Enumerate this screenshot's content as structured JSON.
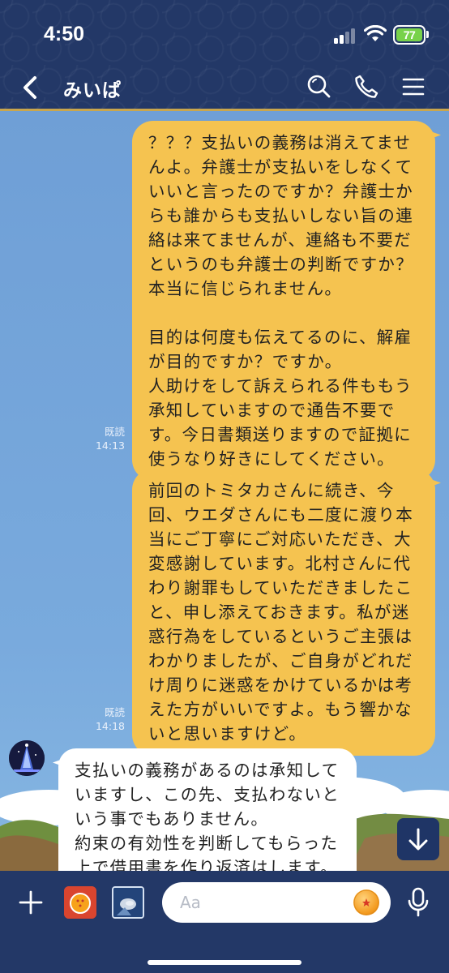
{
  "status_bar": {
    "time": "4:50",
    "battery": "77",
    "colors": {
      "battery": "#78d24a"
    }
  },
  "header": {
    "title": "みいぱ",
    "icons": [
      "back-icon",
      "search-icon",
      "call-icon",
      "menu-icon"
    ]
  },
  "messages": [
    {
      "direction": "out",
      "read": "既読",
      "time": "14:13",
      "text": "？？？支払いの義務は消えてませんよ。弁護士が支払いをしなくていいと言ったのですか？弁護士からも誰からも支払いしない旨の連絡は来てませんが、連絡も不要だというのも弁護士の判断ですか？本当に信じられません。\n\n目的は何度も伝えてるのに、解雇が目的ですか？ですか。\n人助けをして訴えられる件ももう承知していますので通告不要です。今日書類送りますので証拠に使うなり好きにしてください。"
    },
    {
      "direction": "out",
      "read": "既読",
      "time": "14:18",
      "text": "前回のトミタカさんに続き、今回、ウエダさんにも二度に渡り本当にご丁寧にご対応いただき、大変感謝しています。北村さんに代わり謝罪もしていただきましたこと、申し添えておきます。私が迷惑行為をしているというご主張はわかりましたが、ご自身がどれだけ周りに迷惑をかけているかは考えた方がいいですよ。もう響かないと思いますけど。"
    },
    {
      "direction": "in",
      "text": "支払いの義務があるのは承知していますし、この先、支払わないという事でもありません。\n約束の有効性を判断してもらった上で借用書を作り返済はします。"
    }
  ],
  "input_bar": {
    "placeholder": "Aa",
    "icons": [
      "plus-icon",
      "sticker-icon",
      "photo-icon",
      "emoji-icon",
      "mic-icon"
    ]
  },
  "colors": {
    "header_bg": "#233867",
    "chat_bg": "#79aadd",
    "outgoing_bubble": "#f5c350",
    "incoming_bubble": "#ffffff",
    "accent_line": "#c9a64d"
  }
}
